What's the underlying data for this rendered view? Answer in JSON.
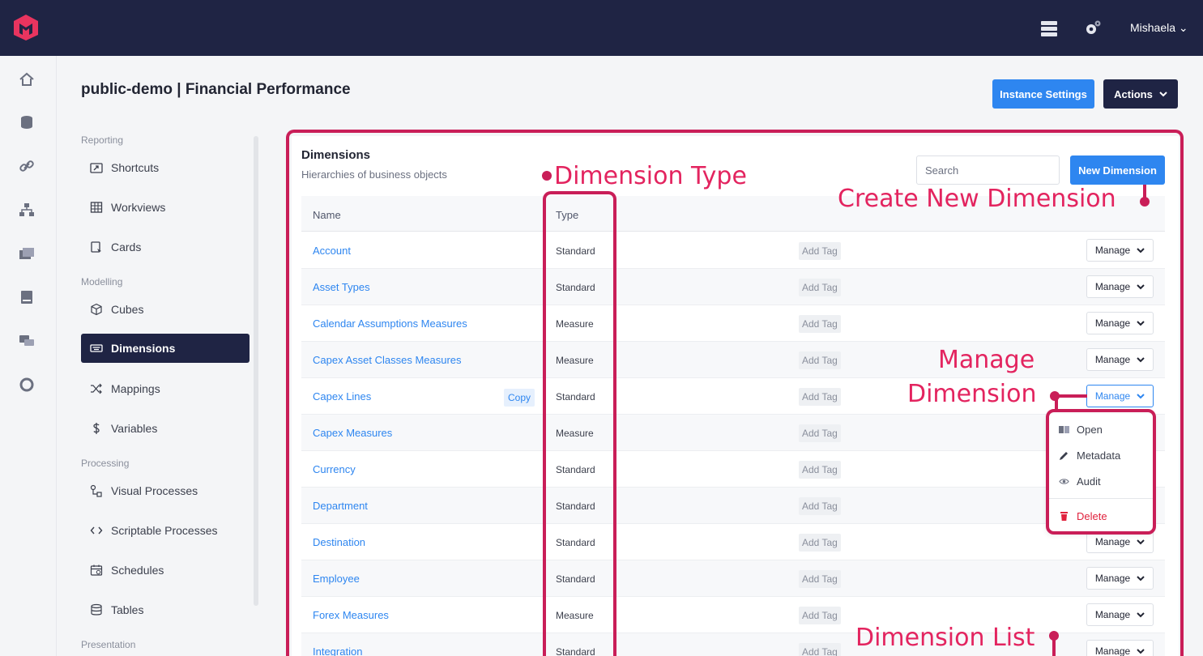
{
  "topbar": {
    "user": "Mishaela ⌄"
  },
  "page": {
    "title": "public-demo | Financial Performance",
    "instance_settings": "Instance Settings",
    "actions": "Actions"
  },
  "sidebar": {
    "sections": [
      "Reporting",
      "Modelling",
      "Processing",
      "Presentation"
    ],
    "items": [
      {
        "label": "Shortcuts",
        "icon": "shortcut-icon"
      },
      {
        "label": "Workviews",
        "icon": "grid-icon"
      },
      {
        "label": "Cards",
        "icon": "card-icon"
      },
      {
        "label": "Cubes",
        "icon": "cube-icon"
      },
      {
        "label": "Dimensions",
        "icon": "keyboard-icon"
      },
      {
        "label": "Mappings",
        "icon": "shuffle-icon"
      },
      {
        "label": "Variables",
        "icon": "dollar-icon"
      },
      {
        "label": "Visual Processes",
        "icon": "process-icon"
      },
      {
        "label": "Scriptable Processes",
        "icon": "code-icon"
      },
      {
        "label": "Schedules",
        "icon": "calendar-icon"
      },
      {
        "label": "Tables",
        "icon": "database-icon"
      }
    ]
  },
  "card": {
    "title": "Dimensions",
    "subtitle": "Hierarchies of business objects",
    "search_placeholder": "Search",
    "new_button": "New Dimension",
    "columns": {
      "name": "Name",
      "type": "Type"
    },
    "add_tag": "Add Tag",
    "manage": "Manage",
    "copy": "Copy",
    "rows": [
      {
        "name": "Account",
        "type": "Standard"
      },
      {
        "name": "Asset Types",
        "type": "Standard"
      },
      {
        "name": "Calendar Assumptions Measures",
        "type": "Measure"
      },
      {
        "name": "Capex Asset Classes Measures",
        "type": "Measure"
      },
      {
        "name": "Capex Lines",
        "type": "Standard"
      },
      {
        "name": "Capex Measures",
        "type": "Measure"
      },
      {
        "name": "Currency",
        "type": "Standard"
      },
      {
        "name": "Department",
        "type": "Standard"
      },
      {
        "name": "Destination",
        "type": "Standard"
      },
      {
        "name": "Employee",
        "type": "Standard"
      },
      {
        "name": "Forex Measures",
        "type": "Measure"
      },
      {
        "name": "Integration",
        "type": "Standard"
      }
    ]
  },
  "dropdown": {
    "open": "Open",
    "metadata": "Metadata",
    "audit": "Audit",
    "delete": "Delete"
  },
  "annotations": {
    "dimension_type": "Dimension Type",
    "create_new": "Create New Dimension",
    "manage_line1": "Manage",
    "manage_line2": "Dimension",
    "list": "Dimension List"
  },
  "colors": {
    "accent": "#2e86f0",
    "nav": "#1f2444",
    "annotation": "#c91e58",
    "danger": "#e0223d"
  }
}
